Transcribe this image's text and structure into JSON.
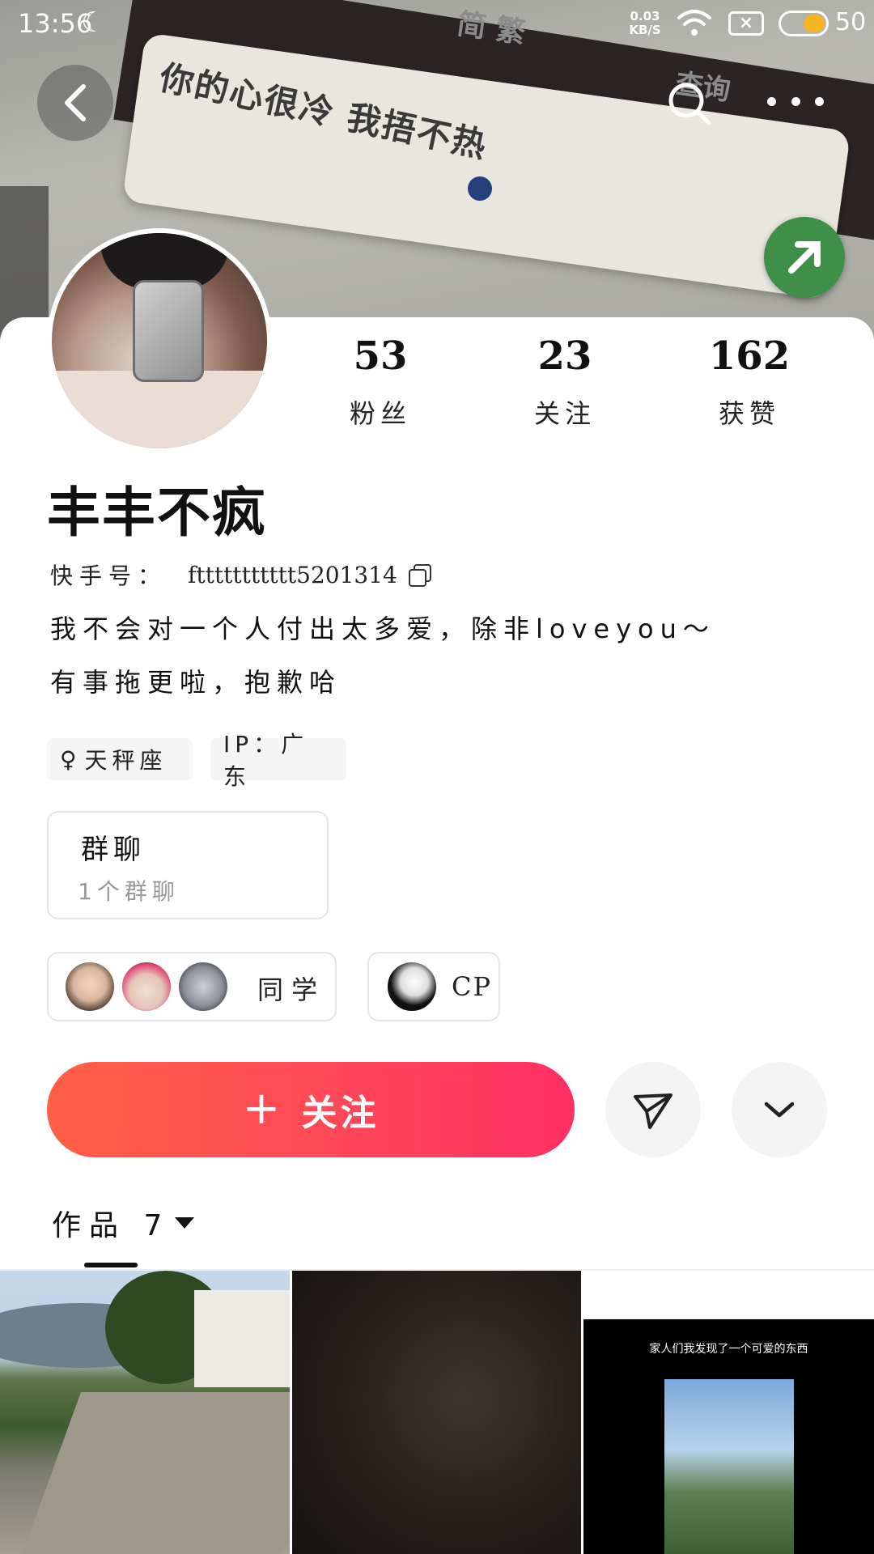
{
  "status_bar": {
    "time": "13:56",
    "net_speed_value": "0.03",
    "net_speed_unit": "KB/S",
    "sim_badge": "×",
    "battery": "50"
  },
  "banner": {
    "bubble_text": "你的心很冷 我捂不热",
    "top_label_1": "简 繁",
    "top_label_2": "查询"
  },
  "profile": {
    "name": "丰丰不疯",
    "kuaishou_id_label": "快手号：",
    "kuaishou_id": "fttttttttttt5201314",
    "bio_line_1": "我不会对一个人付出太多爱，除非loveyou～",
    "bio_line_2": "有事拖更啦，抱歉哈",
    "stats": [
      {
        "value": "53",
        "label": "粉丝"
      },
      {
        "value": "23",
        "label": "关注"
      },
      {
        "value": "162",
        "label": "获赞"
      }
    ],
    "tags": [
      {
        "icon": "♀",
        "label": "天秤座"
      },
      {
        "label": "IP：广东"
      }
    ]
  },
  "group_chat": {
    "title": "群聊",
    "subtitle": "1个群聊"
  },
  "relations": [
    {
      "label": "同学"
    },
    {
      "label": "CP"
    }
  ],
  "actions": {
    "follow_icon": "+",
    "follow_label": "关注"
  },
  "works": {
    "tab_label": "作品 7",
    "thumbnails": [
      {
        "caption": ""
      },
      {
        "caption": ""
      },
      {
        "caption": "家人们我发现了一个可爱的东西"
      }
    ]
  },
  "colors": {
    "follow_gradient_start": "#ff5f45",
    "follow_gradient_end": "#ff2f62",
    "battery_fill": "#f5b423"
  }
}
